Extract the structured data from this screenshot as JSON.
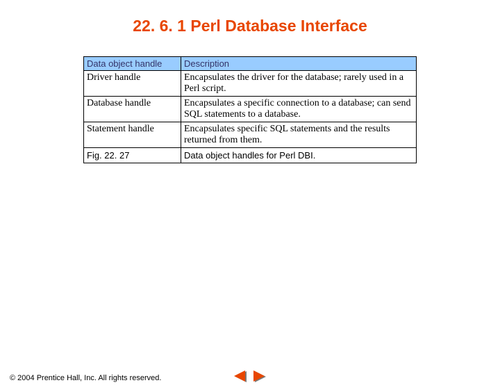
{
  "title": "22. 6. 1 Perl Database Interface",
  "table": {
    "head": {
      "c0": "Data object handle",
      "c1": "Description"
    },
    "rows": [
      {
        "name": "Driver handle",
        "desc": "Encapsulates the driver for the database; rarely used in a Perl script."
      },
      {
        "name": "Database handle",
        "desc": "Encapsulates a specific connection to a database; can send SQL statements to a database."
      },
      {
        "name": "Statement handle",
        "desc": "Encapsulates specific SQL statements and the results returned from them."
      }
    ],
    "caption": {
      "fig": "Fig. 22. 27",
      "text": "Data object handles for Perl DBI."
    }
  },
  "footer": {
    "copyright": "© 2004 Prentice Hall, Inc.  All rights reserved."
  },
  "nav": {
    "prev_icon": "triangle-left-icon",
    "next_icon": "triangle-right-icon"
  },
  "colors": {
    "title": "#e84600",
    "header_bg": "#99ccff",
    "arrow_fill": "#e84600",
    "arrow_shadow": "#7a7a7a"
  }
}
